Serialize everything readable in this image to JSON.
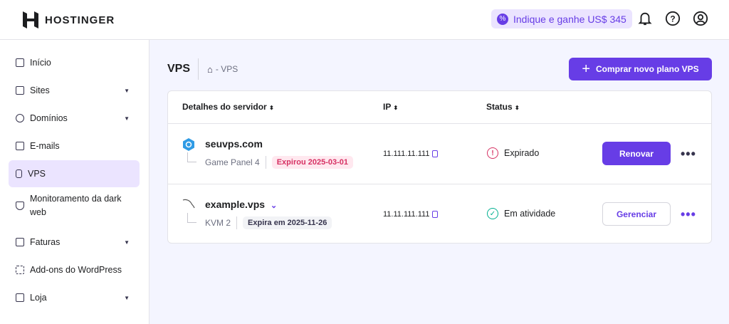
{
  "header": {
    "brand": "HOSTINGER",
    "referral": "Indique e ganhe US$ 345"
  },
  "sidebar": {
    "items": [
      {
        "label": "Início"
      },
      {
        "label": "Sites",
        "caret": true
      },
      {
        "label": "Domínios",
        "caret": true
      },
      {
        "label": "E-mails"
      },
      {
        "label": "VPS",
        "active": true
      },
      {
        "label": "Monitoramento da dark web"
      },
      {
        "label": "Faturas",
        "caret": true
      },
      {
        "label": "Add-ons do WordPress"
      },
      {
        "label": "Loja",
        "caret": true
      }
    ]
  },
  "page": {
    "title": "VPS",
    "breadcrumb": "- VPS",
    "buy_label": "Comprar novo plano VPS"
  },
  "table": {
    "headers": [
      "Detalhes do servidor",
      "IP",
      "Status"
    ],
    "rows": [
      {
        "name": "seuvps.com",
        "plan": "Game Panel 4",
        "badge": "Expirou 2025-03-01",
        "ip": "11.111.11.111",
        "status": "Expirado",
        "action": "Renovar"
      },
      {
        "name": "example.vps",
        "plan": "KVM 2",
        "badge": "Expira em 2025-11-26",
        "ip": "11.11.111.111",
        "status": "Em atividade",
        "action": "Gerenciar"
      }
    ]
  },
  "colors": {
    "accent": "#673de6",
    "danger": "#d63163",
    "success": "#00b090"
  }
}
